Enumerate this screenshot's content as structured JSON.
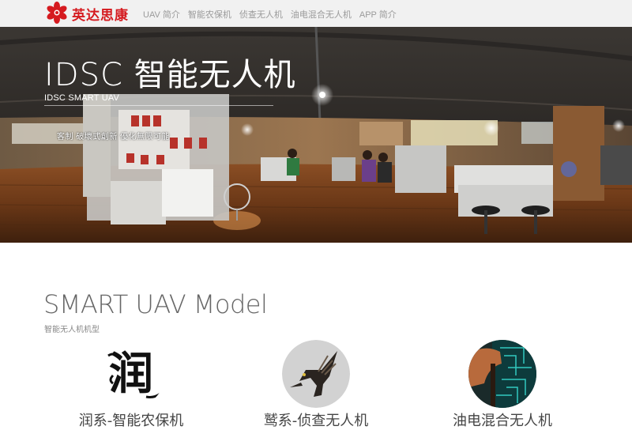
{
  "brand": {
    "name": "英达思康",
    "color": "#d51a1f"
  },
  "nav": {
    "items": [
      {
        "label": "UAV 简介"
      },
      {
        "label": "智能农保机"
      },
      {
        "label": "侦查无人机"
      },
      {
        "label": "油电混合无人机"
      },
      {
        "label": "APP 简介"
      }
    ]
  },
  "hero": {
    "title": "IDSC 智能无人机",
    "subtitle": "IDSC SMART UAV",
    "slogan": "客制 破壞式創新 優化無限可能"
  },
  "models_section": {
    "title": "SMART UAV Model",
    "subtitle": "智能无人机机型",
    "items": [
      {
        "caption": "润系-智能农保机",
        "icon": "calligraphy-run-icon",
        "logo_text": "润"
      },
      {
        "caption": "鹫系-侦查无人机",
        "icon": "eagle-icon"
      },
      {
        "caption": "油电混合无人机",
        "icon": "circuit-board-hand-icon"
      }
    ]
  }
}
